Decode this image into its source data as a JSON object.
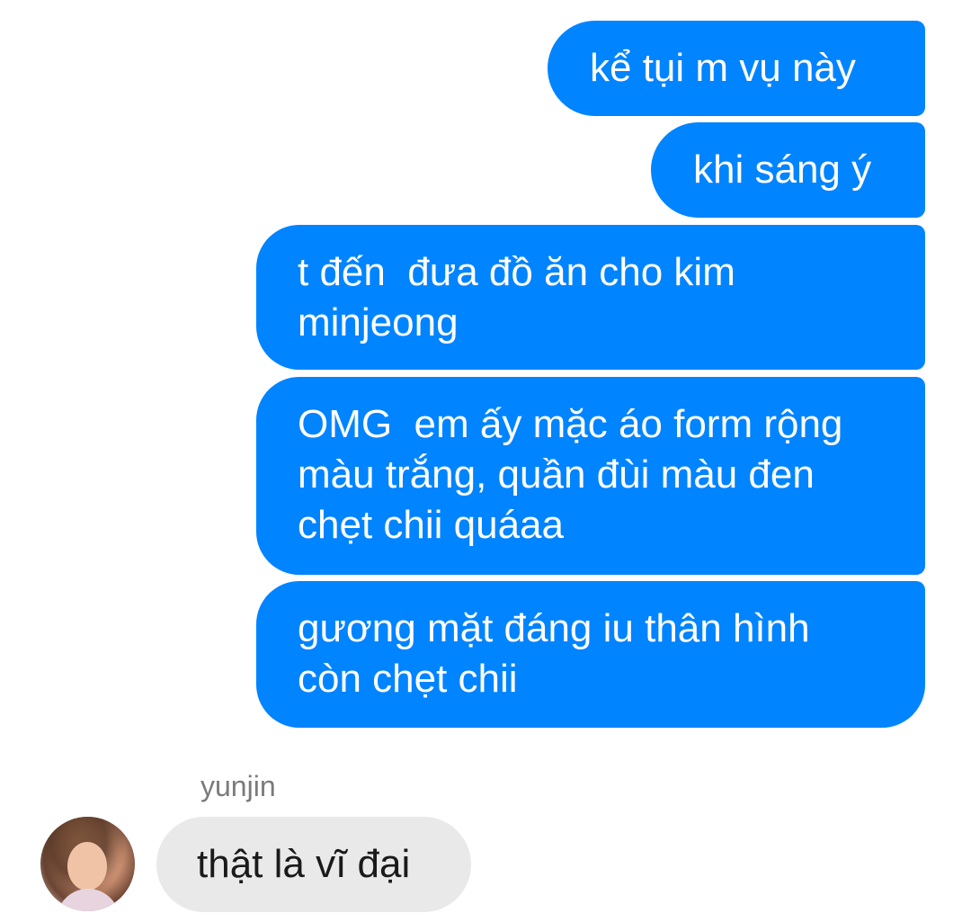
{
  "conversation": {
    "outgoing": [
      {
        "text": "kể tụi m vụ này"
      },
      {
        "text": "khi sáng ý"
      },
      {
        "text": "t đến  đưa đồ ăn cho kim\nminjeong"
      },
      {
        "text": "OMG  em ấy mặc áo form rộng\nmàu trắng, quần đùi màu đen\nchẹt chii quáaa"
      },
      {
        "text": "gương mặt đáng iu thân hình\ncòn chẹt chii"
      }
    ],
    "incoming": {
      "sender": "yunjin",
      "text": "thật là vĩ đại"
    }
  },
  "colors": {
    "outgoing_bubble": "#0084ff",
    "incoming_bubble": "#e9e9e9",
    "sender_name": "#7a7a7a"
  }
}
